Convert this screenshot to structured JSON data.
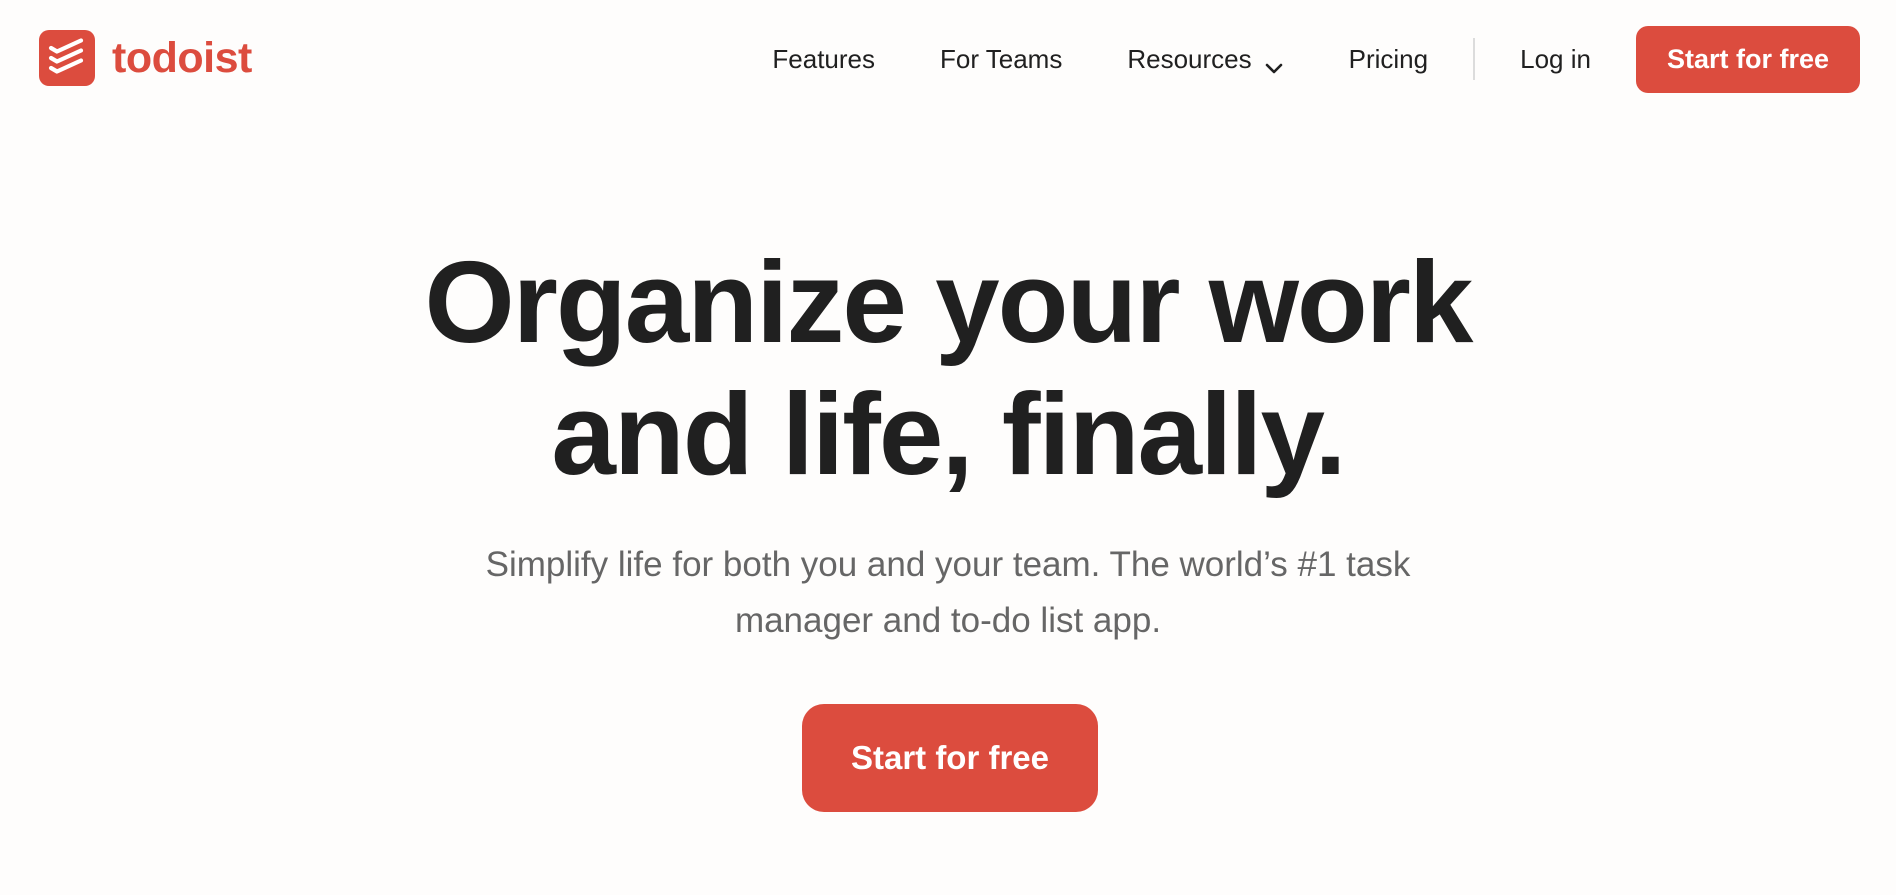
{
  "brand": {
    "name": "todoist",
    "logo_icon": "todoist-layers-icon",
    "color": "#dc4c3e"
  },
  "nav": {
    "items": [
      {
        "label": "Features"
      },
      {
        "label": "For Teams"
      },
      {
        "label": "Resources",
        "icon": "chevron-down-icon"
      },
      {
        "label": "Pricing"
      }
    ],
    "login_label": "Log in",
    "cta_label": "Start for free"
  },
  "hero": {
    "title_line1": "Organize your work",
    "title_line2": "and life, finally.",
    "subtitle_line1": "Simplify life for both you and your team. The world’s #1 task",
    "subtitle_line2": "manager and to-do list app.",
    "cta_label": "Start for free"
  },
  "colors": {
    "accent": "#dc4c3e",
    "background": "#fefdfc",
    "text": "#202020",
    "muted_text": "#666666"
  }
}
